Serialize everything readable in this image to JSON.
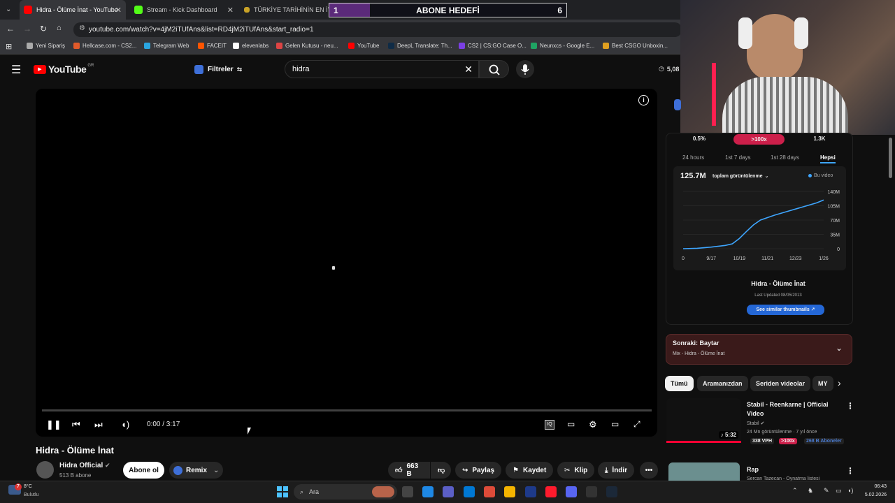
{
  "browser": {
    "tabs": [
      {
        "title": "Hidra - Ölüme İnat - YouTube",
        "active": true
      },
      {
        "title": "Stream - Kick Dashboard",
        "active": false
      },
      {
        "title": "TÜRKİYE TARİHİNİN EN İYİ RA",
        "active": false
      }
    ],
    "url": "youtube.com/watch?v=4jM2iTUfAns&list=RD4jM2iTUfAns&start_radio=1",
    "bookmarks": [
      "Yeni Sipariş",
      "Hellcase.com - CS2...",
      "Telegram Web",
      "FACEIT",
      "elevenlabs",
      "Gelen Kutusu - neu...",
      "YouTube",
      "DeepL Translate: Th...",
      "CS2 | CS:GO Case O...",
      "Neunxcs - Google E...",
      "Best CSGO Unboxin..."
    ]
  },
  "overlay": {
    "label": "ABONE HEDEFİ",
    "current": "1",
    "target": "6",
    "progress": 0.17
  },
  "header": {
    "logo": "YouTube",
    "region": "GR",
    "filters_label": "Filtreler",
    "search_value": "hidra",
    "counter": "5,08"
  },
  "player": {
    "time": "0:00 / 3:17",
    "progress": 0.0
  },
  "video": {
    "title": "Hidra - Ölüme İnat",
    "channel": "Hidra Official",
    "subscribers": "513 B abone",
    "subscribe_label": "Abone ol",
    "remix_label": "Remix",
    "likes": "663 B",
    "share": "Paylaş",
    "save": "Kaydet",
    "clip": "Klip",
    "download": "İndir"
  },
  "stats": {
    "cells": [
      "0.5%",
      ">100x",
      "1.3K"
    ],
    "ranges": [
      "24 hours",
      "1st 7 days",
      "1st 28 days",
      "Hepsi"
    ],
    "selected_range": "Hepsi",
    "total": "125.7M",
    "metric_label": "toplam görüntülenme",
    "legend": "Bu video",
    "video_title": "Hidra - Ölüme İnat",
    "last_updated": "Last Updated 08/05/2013",
    "similar_button": "See similar thumbnails ↗",
    "accent": "#3ea6ff"
  },
  "chart_data": {
    "type": "line",
    "x": [
      "9/17",
      "10/19",
      "11/21",
      "12/23",
      "1/26"
    ],
    "x_start_label": "0",
    "ytick_labels": [
      "0",
      "35M",
      "70M",
      "105M",
      "140M"
    ],
    "ylim": [
      0,
      140
    ],
    "series": [
      {
        "name": "Bu video",
        "points": [
          [
            0,
            0
          ],
          [
            0.1,
            1
          ],
          [
            0.2,
            4
          ],
          [
            0.3,
            8
          ],
          [
            0.35,
            12
          ],
          [
            0.4,
            25
          ],
          [
            0.45,
            42
          ],
          [
            0.5,
            58
          ],
          [
            0.55,
            70
          ],
          [
            0.65,
            82
          ],
          [
            0.75,
            92
          ],
          [
            0.85,
            102
          ],
          [
            0.95,
            112
          ],
          [
            1.0,
            119
          ]
        ]
      }
    ],
    "grid": true,
    "legend_position": "top-right"
  },
  "next": {
    "label": "Sonraki: Baytar",
    "mix": "Mix - Hidra - Ölüme İnat"
  },
  "chips": [
    "Tümü",
    "Aramanızdan",
    "Seriden videolar",
    "MY"
  ],
  "rec": [
    {
      "title": "Stabil - Reenkarne | Official Video",
      "channel": "Stabil",
      "meta": "24 Mn görüntülenme · 7 yıl önce",
      "duration": "5:32",
      "badges": [
        "338 VPH",
        ">100x",
        "268 B Aboneler"
      ]
    },
    {
      "title": "Rap",
      "channel": "Sercan Tazecan - Oynatma listesi"
    }
  ],
  "taskbar": {
    "weather_temp": "8°C",
    "weather_desc": "Bulutlu",
    "search": "Ara",
    "time": "06:43",
    "date": "5.02.2026",
    "notif": "7"
  }
}
